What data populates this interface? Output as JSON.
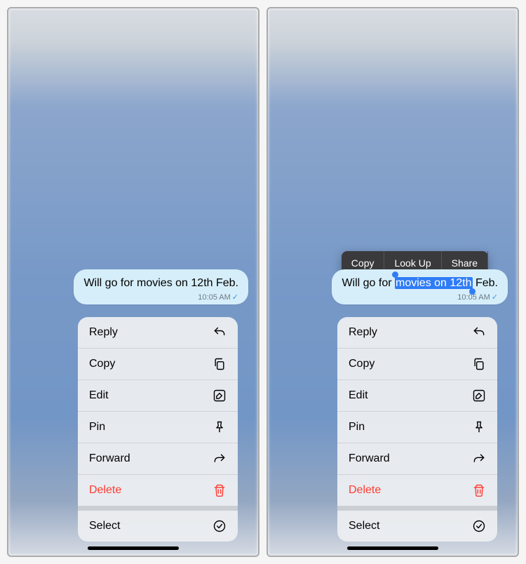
{
  "left": {
    "message_text": "Will go for movies on 12th Feb.",
    "timestamp": "10:05 AM",
    "menu": {
      "reply": "Reply",
      "copy": "Copy",
      "edit": "Edit",
      "pin": "Pin",
      "forward": "Forward",
      "delete": "Delete",
      "select": "Select"
    }
  },
  "right": {
    "message_prefix": "Will go for ",
    "message_selected": "movies on 12th",
    "message_suffix": " Feb.",
    "timestamp": "10:05 AM",
    "callout": {
      "copy": "Copy",
      "lookup": "Look Up",
      "share": "Share"
    },
    "menu": {
      "reply": "Reply",
      "copy": "Copy",
      "edit": "Edit",
      "pin": "Pin",
      "forward": "Forward",
      "delete": "Delete",
      "select": "Select"
    }
  }
}
